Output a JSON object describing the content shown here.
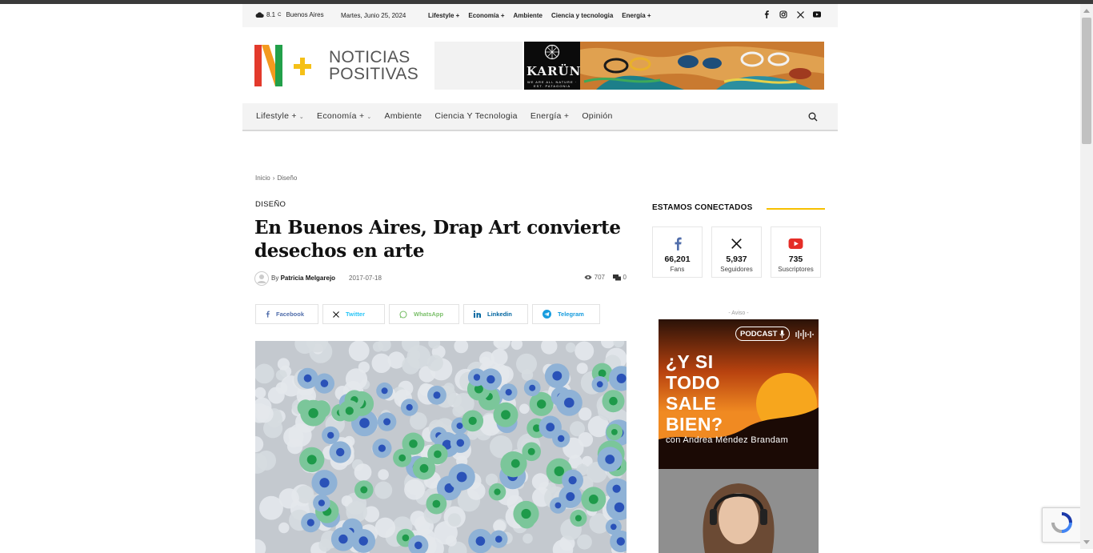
{
  "topbar": {
    "temperature": "8.1",
    "unit": "C",
    "city": "Buenos Aires",
    "date": "Martes, Junio 25, 2024",
    "menu": [
      "Lifestyle +",
      "Economía +",
      "Ambiente",
      "Ciencia y tecnologia",
      "Energía +"
    ],
    "social_icons": [
      "facebook-icon",
      "instagram-icon",
      "x-twitter-icon",
      "youtube-icon"
    ]
  },
  "logo": {
    "line1": "NOTICIAS",
    "line2": "POSITIVAS",
    "plus": "+"
  },
  "banner": {
    "brand": "KARÜN",
    "slogan": "WE ARE ALL NATURE · EST. PATAGONIA"
  },
  "nav": {
    "items": [
      {
        "label": "Lifestyle +",
        "has_dropdown": true
      },
      {
        "label": "Economía +",
        "has_dropdown": true
      },
      {
        "label": "Ambiente",
        "has_dropdown": false
      },
      {
        "label": "Ciencia Y Tecnologia",
        "has_dropdown": false
      },
      {
        "label": "Energía +",
        "has_dropdown": false
      },
      {
        "label": "Opinión",
        "has_dropdown": false
      }
    ],
    "search_icon": "search-icon"
  },
  "breadcrumb": {
    "home": "Inicio",
    "separator": "›",
    "current": "Diseño"
  },
  "article": {
    "category": "DISEÑO",
    "title": "En Buenos Aires, Drap Art convierte desechos en arte",
    "by": "By",
    "author": "Patricia Melgarejo",
    "date": "2017-07-18",
    "views": "707",
    "comments": "0"
  },
  "share": [
    {
      "label": "Facebook",
      "icon": "facebook-icon"
    },
    {
      "label": "Twitter",
      "icon": "x-twitter-icon"
    },
    {
      "label": "WhatsApp",
      "icon": "whatsapp-icon"
    },
    {
      "label": "Linkedin",
      "icon": "linkedin-icon"
    },
    {
      "label": "Telegram",
      "icon": "telegram-icon"
    }
  ],
  "sidebar": {
    "heading": "ESTAMOS CONECTADOS",
    "accent_color": "#f7c000",
    "counters": [
      {
        "count": "66,201",
        "label": "Fans",
        "icon": "facebook-icon",
        "color": "#516eab"
      },
      {
        "count": "5,937",
        "label": "Seguidores",
        "icon": "x-twitter-icon",
        "color": "#111111"
      },
      {
        "count": "735",
        "label": "Suscriptores",
        "icon": "youtube-icon",
        "color": "#e52d27"
      }
    ],
    "ad_label": "- Aviso -",
    "podcast": {
      "badge": "PODCAST",
      "title_lines": [
        "¿Y SI",
        "TODO",
        "SALE",
        "BIEN?"
      ],
      "subtitle": "con Andrea Méndez Brandam"
    }
  }
}
